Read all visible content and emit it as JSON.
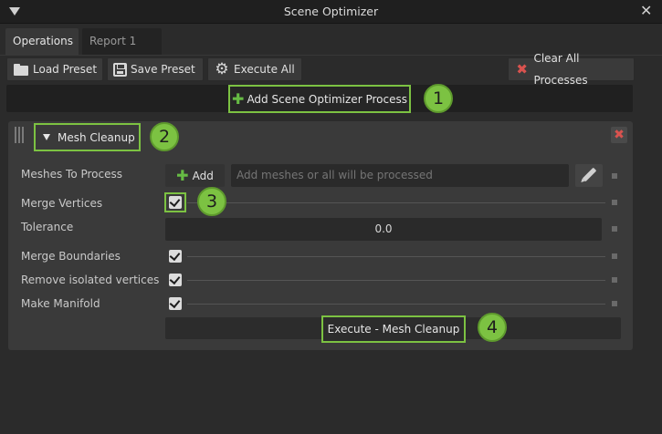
{
  "window": {
    "title": "Scene Optimizer"
  },
  "tabs": [
    {
      "label": "Operations",
      "active": true
    },
    {
      "label": "Report 1",
      "active": false
    }
  ],
  "toolbar": {
    "load_preset": "Load Preset",
    "save_preset": "Save Preset",
    "execute_all": "Execute All",
    "clear_all": "Clear All Processes"
  },
  "add_process_label": "Add Scene Optimizer Process",
  "process": {
    "header": "Mesh Cleanup",
    "meshes_label": "Meshes To Process",
    "add_label": "Add",
    "meshes_placeholder": "Add meshes or all will be processed",
    "merge_vertices_label": "Merge Vertices",
    "merge_vertices_checked": true,
    "tolerance_label": "Tolerance",
    "tolerance_value": "0.0",
    "merge_boundaries_label": "Merge Boundaries",
    "merge_boundaries_checked": true,
    "remove_isolated_label": "Remove isolated vertices",
    "remove_isolated_checked": true,
    "make_manifold_label": "Make Manifold",
    "make_manifold_checked": true,
    "execute_label": "Execute - Mesh Cleanup"
  },
  "callouts": [
    "1",
    "2",
    "3",
    "4"
  ],
  "colors": {
    "accent_green": "#7cc242",
    "danger_red": "#d9534f",
    "background": "#2b2b2b",
    "panel": "#3a3a3a"
  },
  "icons": [
    "menu-triangle-icon",
    "close-icon",
    "folder-icon",
    "save-icon",
    "gear-icon",
    "clear-x-icon",
    "plus-icon",
    "grip-icon",
    "pencil-icon",
    "checkbox-icon"
  ]
}
